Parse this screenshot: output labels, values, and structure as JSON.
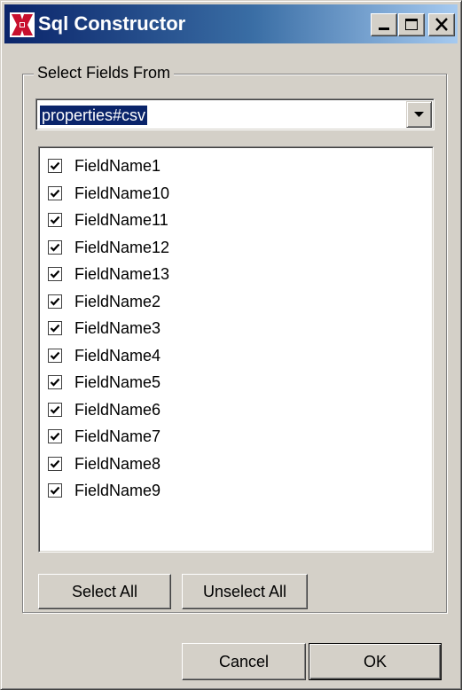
{
  "window": {
    "title": "Sql Constructor",
    "title_gradient_start": "#0a246a",
    "title_gradient_end": "#a6caf0",
    "face_color": "#d4d0c8",
    "app_icon": "sql-constructor-app-icon"
  },
  "caption_buttons": {
    "minimize_icon": "minimize-icon",
    "maximize_icon": "maximize-icon",
    "close_icon": "close-icon"
  },
  "group": {
    "label": "Select Fields From"
  },
  "table_select": {
    "value": "properties#csv",
    "arrow_icon": "chevron-down-icon"
  },
  "fields": [
    {
      "label": "FieldName1",
      "checked": true
    },
    {
      "label": "FieldName10",
      "checked": true
    },
    {
      "label": "FieldName11",
      "checked": true
    },
    {
      "label": "FieldName12",
      "checked": true
    },
    {
      "label": "FieldName13",
      "checked": true
    },
    {
      "label": "FieldName2",
      "checked": true
    },
    {
      "label": "FieldName3",
      "checked": true
    },
    {
      "label": "FieldName4",
      "checked": true
    },
    {
      "label": "FieldName5",
      "checked": true
    },
    {
      "label": "FieldName6",
      "checked": true
    },
    {
      "label": "FieldName7",
      "checked": true
    },
    {
      "label": "FieldName8",
      "checked": true
    },
    {
      "label": "FieldName9",
      "checked": true
    }
  ],
  "buttons": {
    "select_all": "Select All",
    "unselect_all": "Unselect All",
    "cancel": "Cancel",
    "ok": "OK"
  }
}
